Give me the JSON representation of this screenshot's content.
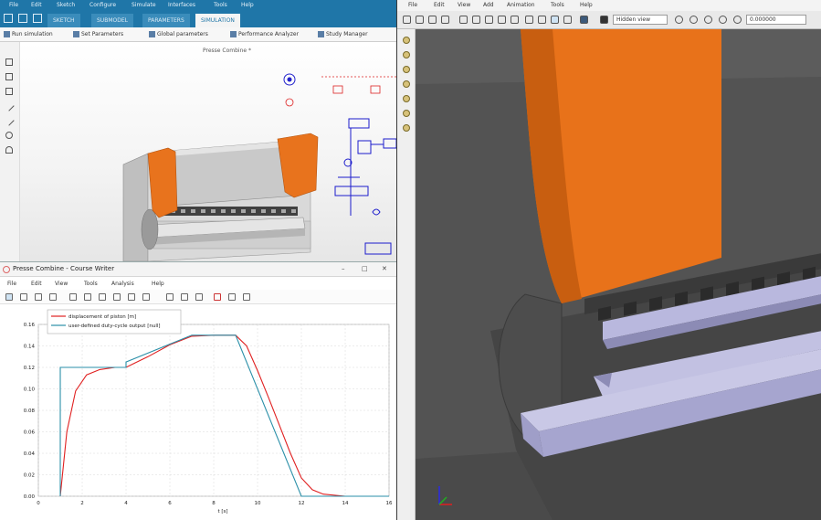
{
  "cad": {
    "menu": [
      "File",
      "Edit",
      "Sketch",
      "Configure",
      "Simulate",
      "Interfaces",
      "Tools",
      "Help"
    ],
    "tabs": [
      "SKETCH",
      "SUBMODEL",
      "PARAMETERS",
      "SIMULATION"
    ],
    "active_tab": "SIMULATION",
    "commands": [
      "Run simulation",
      "Set Parameters",
      "Global parameters",
      "Performance Analyzer",
      "Study Manager"
    ],
    "document_title": "Presse Combine *"
  },
  "plot": {
    "title": "Presse Combine - Course Writer",
    "menu": [
      "File",
      "Edit",
      "View",
      "Tools",
      "Analysis",
      "Help"
    ],
    "window_buttons": [
      "–",
      "□",
      "✕"
    ]
  },
  "chart_data": {
    "type": "line",
    "xlabel": "t [s]",
    "ylabel": "",
    "xlim": [
      0,
      16
    ],
    "ylim": [
      0,
      0.16
    ],
    "xticks": [
      0,
      2,
      4,
      6,
      8,
      10,
      12,
      14,
      16
    ],
    "yticks": [
      0,
      0.02,
      0.04,
      0.06,
      0.08,
      0.1,
      0.12,
      0.14,
      0.16
    ],
    "ytick_labels": [
      "0.00",
      "0.02",
      "0.04",
      "0.06",
      "0.08",
      "0.10",
      "0.12",
      "0.14",
      "0.16"
    ],
    "grid": true,
    "legend_position": "top-center",
    "series": [
      {
        "name": "displacement of piston [m]",
        "color": "#e02020",
        "x": [
          1.0,
          1.3,
          1.7,
          2.2,
          2.8,
          3.5,
          4.0,
          4.4,
          5.0,
          6.0,
          7.0,
          8.0,
          9.0,
          9.5,
          10.0,
          10.5,
          11.0,
          11.5,
          12.0,
          12.5,
          13.0,
          14.0,
          16.0
        ],
        "y": [
          0.0,
          0.06,
          0.098,
          0.113,
          0.118,
          0.12,
          0.12,
          0.124,
          0.13,
          0.141,
          0.149,
          0.15,
          0.15,
          0.14,
          0.117,
          0.092,
          0.066,
          0.04,
          0.017,
          0.006,
          0.002,
          0.0,
          0.0
        ]
      },
      {
        "name": "user-defined duty-cycle output [null]",
        "color": "#2a8fa8",
        "x": [
          1.0,
          1.0,
          4.0,
          4.0,
          7.0,
          9.0,
          12.0,
          16.0
        ],
        "y": [
          0.0,
          0.12,
          0.12,
          0.125,
          0.15,
          0.15,
          0.0,
          0.0
        ]
      }
    ]
  },
  "viewer": {
    "menu": [
      "File",
      "Edit",
      "View",
      "Add",
      "Animation",
      "Tools",
      "Help"
    ],
    "view_mode": "Hidden view",
    "time_value": "0.000000"
  },
  "colors": {
    "accent": "#1f76a8",
    "punch_orange": "#e8721a",
    "viewer_bg": "#5b5b5b",
    "die_lilac": "#b9b8de"
  },
  "icons": [
    "layout-icon",
    "save-icon",
    "undo-icon",
    "play-icon",
    "zoom-icon",
    "rotate-icon",
    "pan-icon",
    "axis-triad-icon"
  ]
}
